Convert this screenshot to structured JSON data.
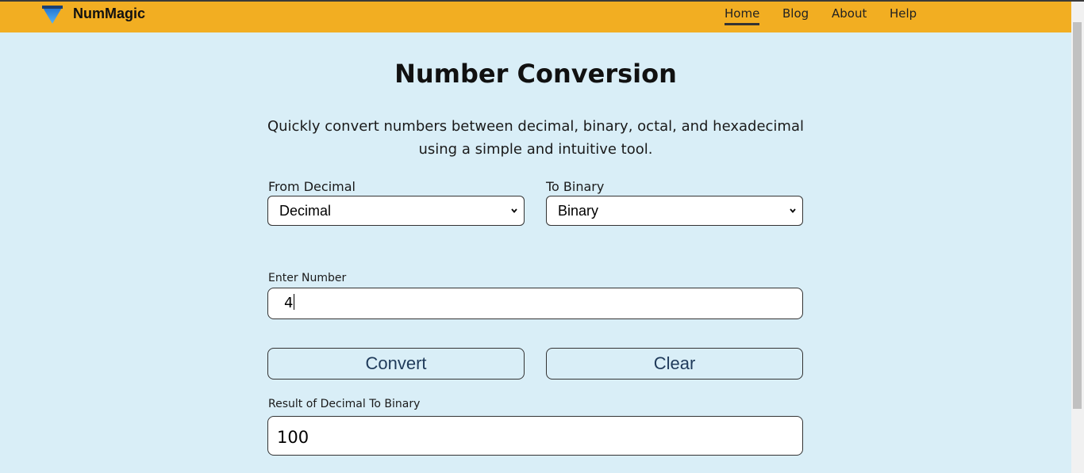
{
  "header": {
    "brand": "NumMagic",
    "logo_icon": "inverted-triangle-logo-icon",
    "nav": [
      {
        "label": "Home",
        "active": true
      },
      {
        "label": "Blog",
        "active": false
      },
      {
        "label": "About",
        "active": false
      },
      {
        "label": "Help",
        "active": false
      }
    ]
  },
  "main": {
    "title": "Number Conversion",
    "description": "Quickly convert numbers between decimal, binary, octal, and hexadecimal using a simple and intuitive tool.",
    "from": {
      "label": "From Decimal",
      "value": "Decimal"
    },
    "to": {
      "label": "To Binary",
      "value": "Binary"
    },
    "input": {
      "label": "Enter Number",
      "value": "4"
    },
    "convert_label": "Convert",
    "clear_label": "Clear",
    "result": {
      "label": "Result of Decimal To Binary",
      "value": "100"
    }
  },
  "colors": {
    "navbar": "#f2ae22",
    "background": "#d9eef7",
    "logo": "#2a7fd6"
  }
}
